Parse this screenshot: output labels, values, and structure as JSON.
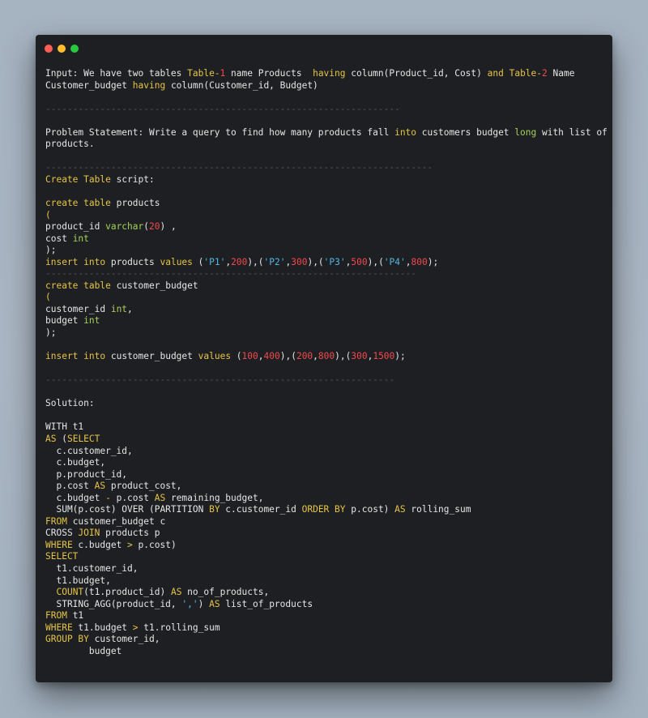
{
  "window": {
    "controls": [
      "close",
      "minimize",
      "zoom"
    ]
  },
  "code_lines": [
    [
      {
        "t": "Input: We have two tables ",
        "c": "p"
      },
      {
        "t": "Table-",
        "c": "k"
      },
      {
        "t": "1",
        "c": "n"
      },
      {
        "t": " name Products  ",
        "c": "p"
      },
      {
        "t": "having",
        "c": "k"
      },
      {
        "t": " column(Product_id, Cost) ",
        "c": "p"
      },
      {
        "t": "and",
        "c": "k"
      },
      {
        "t": " ",
        "c": "p"
      },
      {
        "t": "Table-",
        "c": "k"
      },
      {
        "t": "2",
        "c": "n"
      },
      {
        "t": " Name",
        "c": "p"
      }
    ],
    [
      {
        "t": "Customer_budget ",
        "c": "p"
      },
      {
        "t": "having",
        "c": "k"
      },
      {
        "t": " column(Customer_id, Budget)",
        "c": "p"
      }
    ],
    [],
    [
      {
        "t": "-----------------------------------------------------------------",
        "c": "d"
      }
    ],
    [],
    [
      {
        "t": "Problem Statement: Write a query to find how many products fall ",
        "c": "p"
      },
      {
        "t": "into",
        "c": "k"
      },
      {
        "t": " customers budget ",
        "c": "p"
      },
      {
        "t": "long",
        "c": "t"
      },
      {
        "t": " with list of",
        "c": "p"
      }
    ],
    [
      {
        "t": "products.",
        "c": "p"
      }
    ],
    [],
    [
      {
        "t": "-----------------------------------------------------------------------",
        "c": "d"
      }
    ],
    [
      {
        "t": "Create",
        "c": "k"
      },
      {
        "t": " ",
        "c": "p"
      },
      {
        "t": "Table",
        "c": "k"
      },
      {
        "t": " script:",
        "c": "p"
      }
    ],
    [],
    [
      {
        "t": "create",
        "c": "k"
      },
      {
        "t": " ",
        "c": "p"
      },
      {
        "t": "table",
        "c": "k"
      },
      {
        "t": " products",
        "c": "p"
      }
    ],
    [
      {
        "t": "(",
        "c": "k"
      }
    ],
    [
      {
        "t": "product_id ",
        "c": "p"
      },
      {
        "t": "varchar",
        "c": "t"
      },
      {
        "t": "(",
        "c": "p"
      },
      {
        "t": "20",
        "c": "n"
      },
      {
        "t": ") ,",
        "c": "p"
      }
    ],
    [
      {
        "t": "cost ",
        "c": "p"
      },
      {
        "t": "int",
        "c": "t"
      }
    ],
    [
      {
        "t": ");",
        "c": "p"
      }
    ],
    [
      {
        "t": "insert",
        "c": "k"
      },
      {
        "t": " ",
        "c": "p"
      },
      {
        "t": "into",
        "c": "k"
      },
      {
        "t": " products ",
        "c": "p"
      },
      {
        "t": "values",
        "c": "k"
      },
      {
        "t": " (",
        "c": "p"
      },
      {
        "t": "'P1'",
        "c": "s"
      },
      {
        "t": ",",
        "c": "p"
      },
      {
        "t": "200",
        "c": "n"
      },
      {
        "t": "),(",
        "c": "p"
      },
      {
        "t": "'P2'",
        "c": "s"
      },
      {
        "t": ",",
        "c": "p"
      },
      {
        "t": "300",
        "c": "n"
      },
      {
        "t": "),(",
        "c": "p"
      },
      {
        "t": "'P3'",
        "c": "s"
      },
      {
        "t": ",",
        "c": "p"
      },
      {
        "t": "500",
        "c": "n"
      },
      {
        "t": "),(",
        "c": "p"
      },
      {
        "t": "'P4'",
        "c": "s"
      },
      {
        "t": ",",
        "c": "p"
      },
      {
        "t": "800",
        "c": "n"
      },
      {
        "t": ");",
        "c": "p"
      }
    ],
    [
      {
        "t": "--------------------------------------------------------------------",
        "c": "d"
      }
    ],
    [
      {
        "t": "create",
        "c": "k"
      },
      {
        "t": " ",
        "c": "p"
      },
      {
        "t": "table",
        "c": "k"
      },
      {
        "t": " customer_budget",
        "c": "p"
      }
    ],
    [
      {
        "t": "(",
        "c": "k"
      }
    ],
    [
      {
        "t": "customer_id ",
        "c": "p"
      },
      {
        "t": "int",
        "c": "t"
      },
      {
        "t": ",",
        "c": "p"
      }
    ],
    [
      {
        "t": "budget ",
        "c": "p"
      },
      {
        "t": "int",
        "c": "t"
      }
    ],
    [
      {
        "t": ");",
        "c": "p"
      }
    ],
    [],
    [
      {
        "t": "insert",
        "c": "k"
      },
      {
        "t": " ",
        "c": "p"
      },
      {
        "t": "into",
        "c": "k"
      },
      {
        "t": " customer_budget ",
        "c": "p"
      },
      {
        "t": "values",
        "c": "k"
      },
      {
        "t": " (",
        "c": "p"
      },
      {
        "t": "100",
        "c": "n"
      },
      {
        "t": ",",
        "c": "p"
      },
      {
        "t": "400",
        "c": "n"
      },
      {
        "t": "),(",
        "c": "p"
      },
      {
        "t": "200",
        "c": "n"
      },
      {
        "t": ",",
        "c": "p"
      },
      {
        "t": "800",
        "c": "n"
      },
      {
        "t": "),(",
        "c": "p"
      },
      {
        "t": "300",
        "c": "n"
      },
      {
        "t": ",",
        "c": "p"
      },
      {
        "t": "1500",
        "c": "n"
      },
      {
        "t": ");",
        "c": "p"
      }
    ],
    [],
    [
      {
        "t": "----------------------------------------------------------------",
        "c": "d"
      }
    ],
    [],
    [
      {
        "t": "Solution:",
        "c": "p"
      }
    ],
    [],
    [
      {
        "t": "WITH t1",
        "c": "p"
      }
    ],
    [
      {
        "t": "AS",
        "c": "k"
      },
      {
        "t": " (",
        "c": "p"
      },
      {
        "t": "SELECT",
        "c": "k"
      }
    ],
    [
      {
        "t": "  c.customer_id,",
        "c": "p"
      }
    ],
    [
      {
        "t": "  c.budget,",
        "c": "p"
      }
    ],
    [
      {
        "t": "  p.product_id,",
        "c": "p"
      }
    ],
    [
      {
        "t": "  p.cost ",
        "c": "p"
      },
      {
        "t": "AS",
        "c": "k"
      },
      {
        "t": " product_cost,",
        "c": "p"
      }
    ],
    [
      {
        "t": "  c.budget ",
        "c": "p"
      },
      {
        "t": "-",
        "c": "k"
      },
      {
        "t": " p.cost ",
        "c": "p"
      },
      {
        "t": "AS",
        "c": "k"
      },
      {
        "t": " remaining_budget,",
        "c": "p"
      }
    ],
    [
      {
        "t": "  SUM(p.cost) OVER (PARTITION ",
        "c": "p"
      },
      {
        "t": "BY",
        "c": "k"
      },
      {
        "t": " c.customer_id ",
        "c": "p"
      },
      {
        "t": "ORDER",
        "c": "k"
      },
      {
        "t": " ",
        "c": "p"
      },
      {
        "t": "BY",
        "c": "k"
      },
      {
        "t": " p.cost) ",
        "c": "p"
      },
      {
        "t": "AS",
        "c": "k"
      },
      {
        "t": " rolling_sum",
        "c": "p"
      }
    ],
    [
      {
        "t": "FROM",
        "c": "k"
      },
      {
        "t": " customer_budget c",
        "c": "p"
      }
    ],
    [
      {
        "t": "CROSS ",
        "c": "p"
      },
      {
        "t": "JOIN",
        "c": "k"
      },
      {
        "t": " products p",
        "c": "p"
      }
    ],
    [
      {
        "t": "WHERE",
        "c": "k"
      },
      {
        "t": " c.budget ",
        "c": "p"
      },
      {
        "t": ">",
        "c": "k"
      },
      {
        "t": " p.cost)",
        "c": "p"
      }
    ],
    [
      {
        "t": "SELECT",
        "c": "k"
      }
    ],
    [
      {
        "t": "  t1.customer_id,",
        "c": "p"
      }
    ],
    [
      {
        "t": "  t1.budget,",
        "c": "p"
      }
    ],
    [
      {
        "t": "  ",
        "c": "p"
      },
      {
        "t": "COUNT",
        "c": "k"
      },
      {
        "t": "(t1.product_id) ",
        "c": "p"
      },
      {
        "t": "AS",
        "c": "k"
      },
      {
        "t": " no_of_products,",
        "c": "p"
      }
    ],
    [
      {
        "t": "  STRING_AGG(product_id, ",
        "c": "p"
      },
      {
        "t": "','",
        "c": "s"
      },
      {
        "t": ") ",
        "c": "p"
      },
      {
        "t": "AS",
        "c": "k"
      },
      {
        "t": " list_of_products",
        "c": "p"
      }
    ],
    [
      {
        "t": "FROM",
        "c": "k"
      },
      {
        "t": " t1",
        "c": "p"
      }
    ],
    [
      {
        "t": "WHERE",
        "c": "k"
      },
      {
        "t": " t1.budget ",
        "c": "p"
      },
      {
        "t": ">",
        "c": "k"
      },
      {
        "t": " t1.rolling_sum",
        "c": "p"
      }
    ],
    [
      {
        "t": "GROUP BY",
        "c": "k"
      },
      {
        "t": " customer_id,",
        "c": "p"
      }
    ],
    [
      {
        "t": "        budget",
        "c": "p"
      }
    ]
  ]
}
